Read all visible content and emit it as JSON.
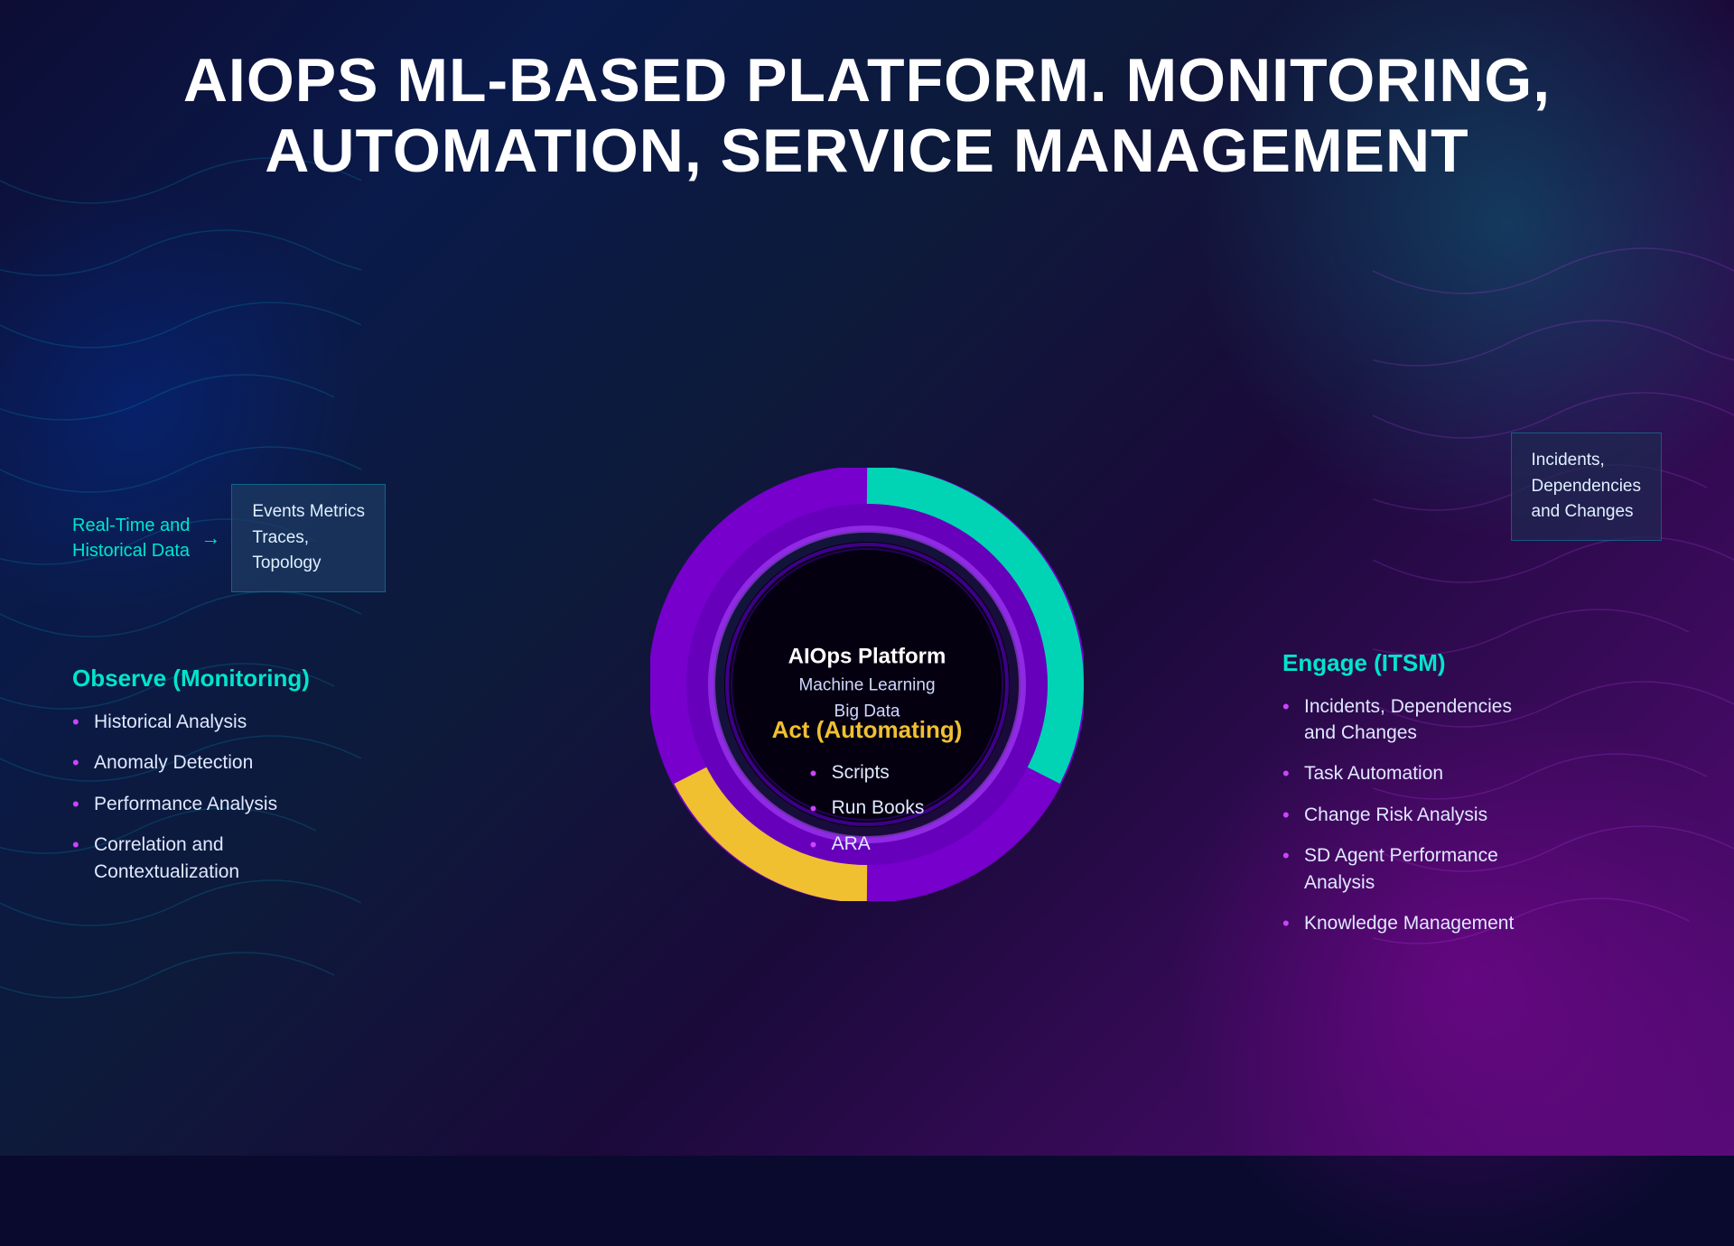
{
  "title": {
    "line1": "AIOPS ML-BASED PLATFORM. MONITORING,",
    "line2": "AUTOMATION, SERVICE MANAGEMENT"
  },
  "data_flow": {
    "source_label": "Real-Time and\nHistorical Data",
    "arrow": "→",
    "box_label": "Events Metrics\nTraces,\nTopology"
  },
  "incidents_box": {
    "label": "Incidents,\nDependencies\nand Changes"
  },
  "observe": {
    "title": "Observe (Monitoring)",
    "items": [
      "Historical Analysis",
      "Anomaly Detection",
      "Performance Analysis",
      "Correlation and\nContextualization"
    ]
  },
  "engage": {
    "title": "Engage (ITSM)",
    "items": [
      "Incidents, Dependencies\nand Changes",
      "Task Automation",
      "Change Risk Analysis",
      "SD Agent Performance\nAnalysis",
      "Knowledge Management"
    ]
  },
  "act": {
    "title": "Act (Automating)",
    "items": [
      "Scripts",
      "Run Books",
      "ARA"
    ]
  },
  "center": {
    "platform": "AIOps Platform",
    "line1": "Machine Learning",
    "line2": "Big Data"
  },
  "colors": {
    "teal": "#00e5cc",
    "purple": "#cc44ff",
    "gold": "#f0c030",
    "white": "#ffffff",
    "light_blue": "#e0e8ff"
  }
}
